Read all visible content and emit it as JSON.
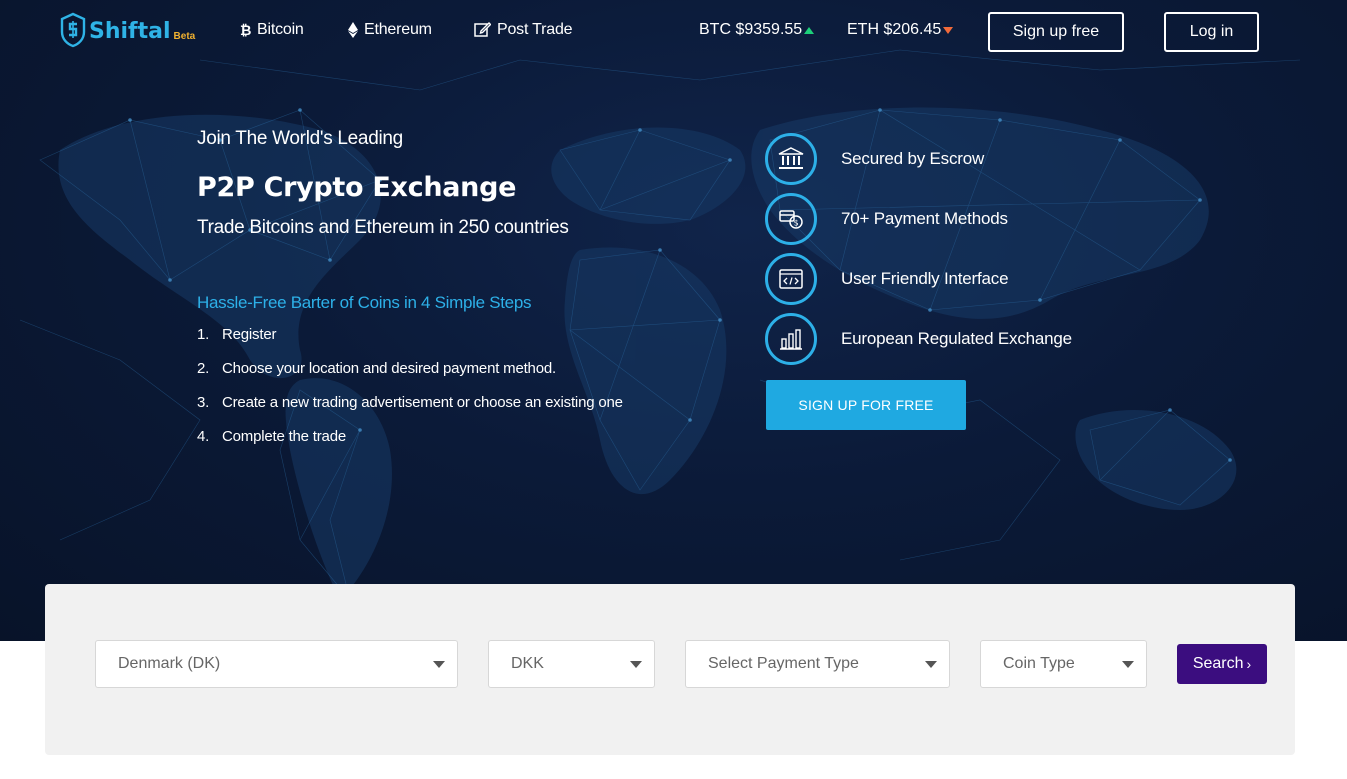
{
  "brand": {
    "name": "Shiftal",
    "badge": "Beta",
    "accent": "#2fb3e6"
  },
  "nav": {
    "links": [
      {
        "label": "Bitcoin",
        "icon": "bitcoin-icon"
      },
      {
        "label": "Ethereum",
        "icon": "ethereum-icon"
      },
      {
        "label": "Post Trade",
        "icon": "edit-icon"
      }
    ],
    "tickers": [
      {
        "label": "BTC $9359.55",
        "trend": "up",
        "color": "#1dd07a"
      },
      {
        "label": "ETH $206.45",
        "trend": "down",
        "color": "#f26a3a"
      }
    ],
    "signup_label": "Sign up free",
    "login_label": "Log in"
  },
  "hero": {
    "kicker": "Join The World's Leading",
    "headline": "P2P Crypto Exchange",
    "subhead": "Trade Bitcoins and Ethereum in 250 countries",
    "steps_title": "Hassle-Free Barter of Coins in 4 Simple Steps",
    "steps": [
      {
        "num": "1.",
        "text": "Register"
      },
      {
        "num": "2.",
        "text": "Choose your location and desired payment method."
      },
      {
        "num": "3.",
        "text": "Create a new trading advertisement or choose an existing one"
      },
      {
        "num": "4.",
        "text": "Complete the trade"
      }
    ]
  },
  "features": [
    {
      "label": "Secured by Escrow",
      "icon": "bank-icon"
    },
    {
      "label": "70+ Payment Methods",
      "icon": "payment-icon"
    },
    {
      "label": "User Friendly Interface",
      "icon": "code-window-icon"
    },
    {
      "label": "European Regulated Exchange",
      "icon": "regulated-chart-icon"
    }
  ],
  "cta_label": "SIGN UP FOR FREE",
  "search": {
    "country": "Denmark (DK)",
    "currency": "DKK",
    "payment_placeholder": "Select Payment Type",
    "coin_placeholder": "Coin Type",
    "button_label": "Search",
    "button_color": "#3b0d7f"
  }
}
